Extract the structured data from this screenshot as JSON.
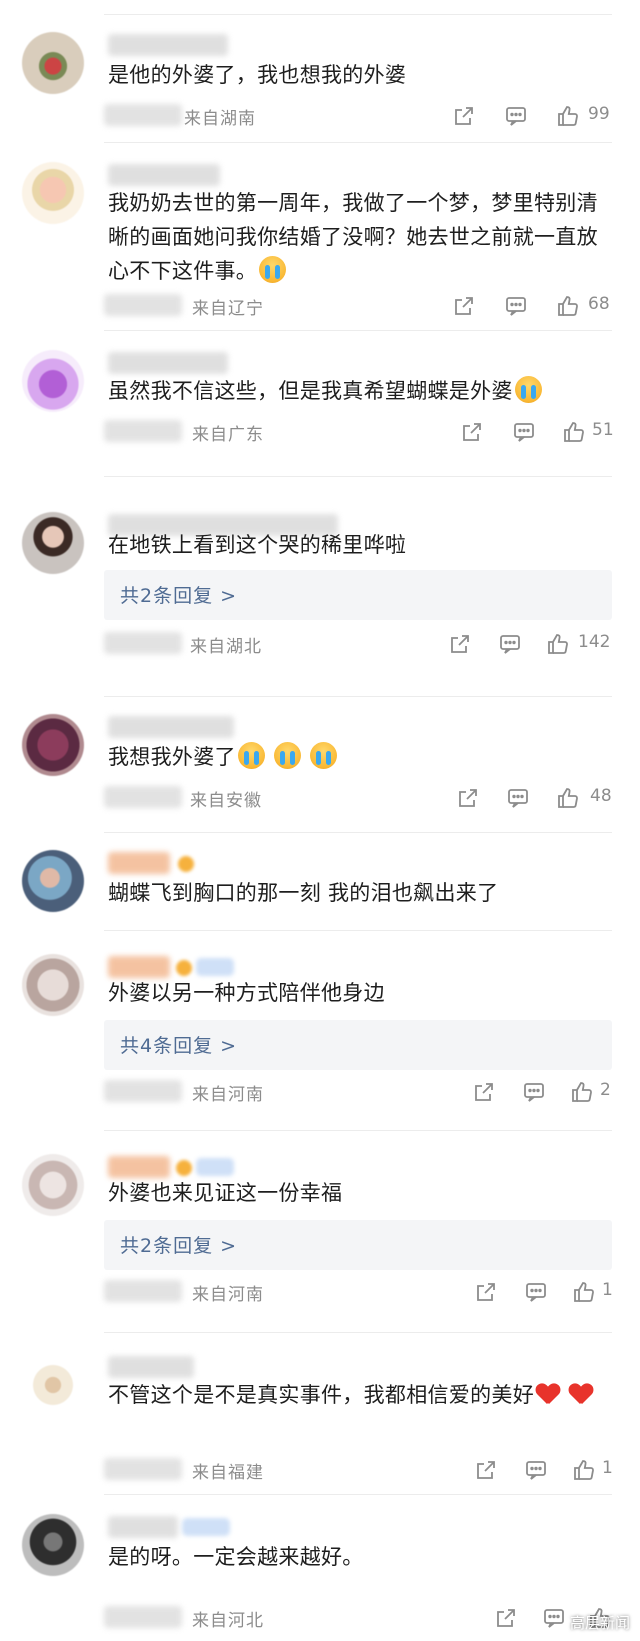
{
  "comments": [
    {
      "text": "是他的外婆了，我也想我的外婆",
      "location": "来自湖南",
      "likes": "99"
    },
    {
      "text": "我奶奶去世的第一周年，我做了一个梦，梦里特别清晰的画面她问我你结婚了没啊？她去世之前就一直放心不下这件事。",
      "location": "来自辽宁",
      "likes": "68"
    },
    {
      "text": "虽然我不信这些，但是我真希望蝴蝶是外婆",
      "location": "来自广东",
      "likes": "51"
    },
    {
      "text": "在地铁上看到这个哭的稀里哗啦",
      "reply": "共2条回复 >",
      "location": "来自湖北",
      "likes": "142"
    },
    {
      "text": "我想我外婆了",
      "location": "来自安徽",
      "likes": "48"
    },
    {
      "text": "蝴蝶飞到胸口的那一刻 我的泪也飙出来了"
    },
    {
      "text": "外婆以另一种方式陪伴他身边",
      "reply": "共4条回复 >",
      "location": "来自河南",
      "likes": "2"
    },
    {
      "text": "外婆也来见证这一份幸福",
      "reply": "共2条回复 >",
      "location": "来自河南",
      "likes": "1"
    },
    {
      "text": "不管这个是不是真实事件，我都相信爱的美好",
      "location": "来自福建",
      "likes": "1"
    },
    {
      "text": "是的呀。一定会越来越好。",
      "location": "来自河北",
      "likes": ""
    }
  ],
  "watermark": "高层新闻",
  "colors": {
    "reply_link": "#4f6b93",
    "meta": "#8c8c8c",
    "reply_bg": "#f4f5f7"
  }
}
